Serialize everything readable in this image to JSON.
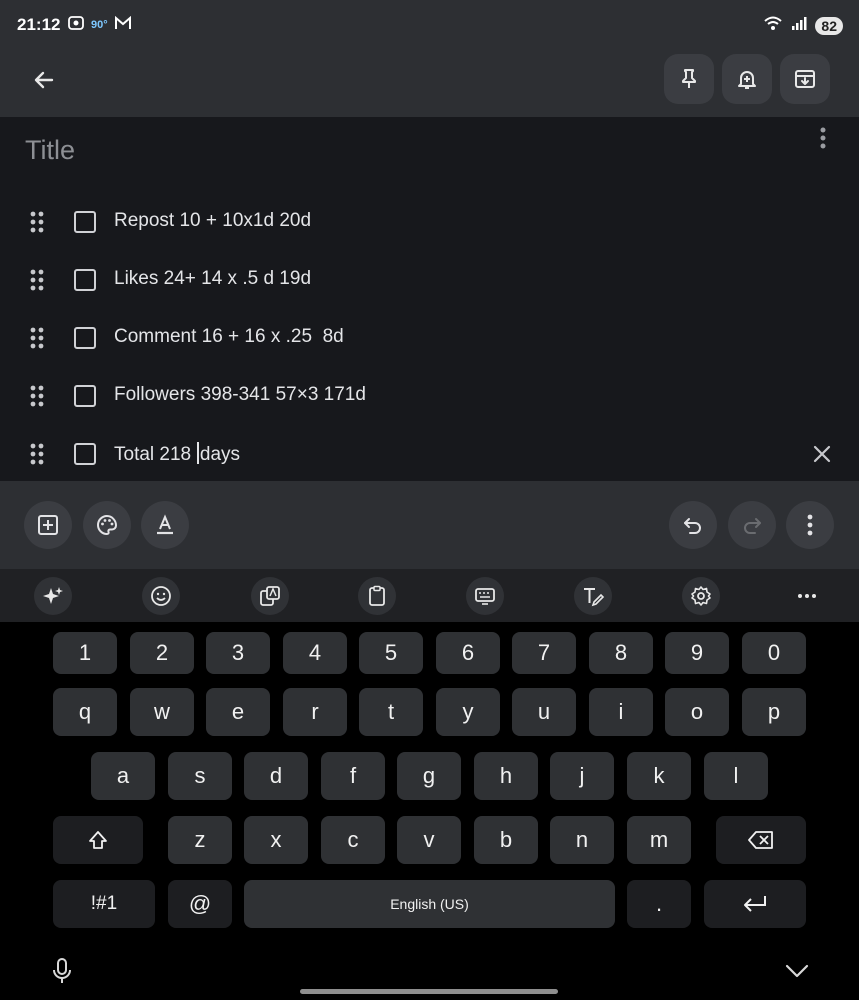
{
  "status_bar": {
    "time": "21:12",
    "temp": "90°",
    "battery": "82"
  },
  "note": {
    "title_placeholder": "Title",
    "items": [
      {
        "text": "Repost 10 + 10x1d 20d",
        "checked": false
      },
      {
        "text": "Likes 24+ 14 x .5 d 19d",
        "checked": false
      },
      {
        "text": "Comment 16 + 16 x .25  8d",
        "checked": false
      },
      {
        "text": "Followers 398-341 57×3 171d",
        "checked": false
      },
      {
        "text_before_cursor": "Total 218 ",
        "text_after_cursor": "days",
        "checked": false
      }
    ]
  },
  "keyboard": {
    "row_numbers": [
      "1",
      "2",
      "3",
      "4",
      "5",
      "6",
      "7",
      "8",
      "9",
      "0"
    ],
    "row_top": [
      "q",
      "w",
      "e",
      "r",
      "t",
      "y",
      "u",
      "i",
      "o",
      "p"
    ],
    "row_mid": [
      "a",
      "s",
      "d",
      "f",
      "g",
      "h",
      "j",
      "k",
      "l"
    ],
    "row_bottom": [
      "z",
      "x",
      "c",
      "v",
      "b",
      "n",
      "m"
    ],
    "symbols_label": "!#1",
    "at_label": "@",
    "space_label": "English (US)",
    "period_label": "."
  },
  "colors": {
    "note_bg": "#17181c",
    "toolbar_bg": "#2d2f33",
    "keyboard_bg": "#000000"
  }
}
